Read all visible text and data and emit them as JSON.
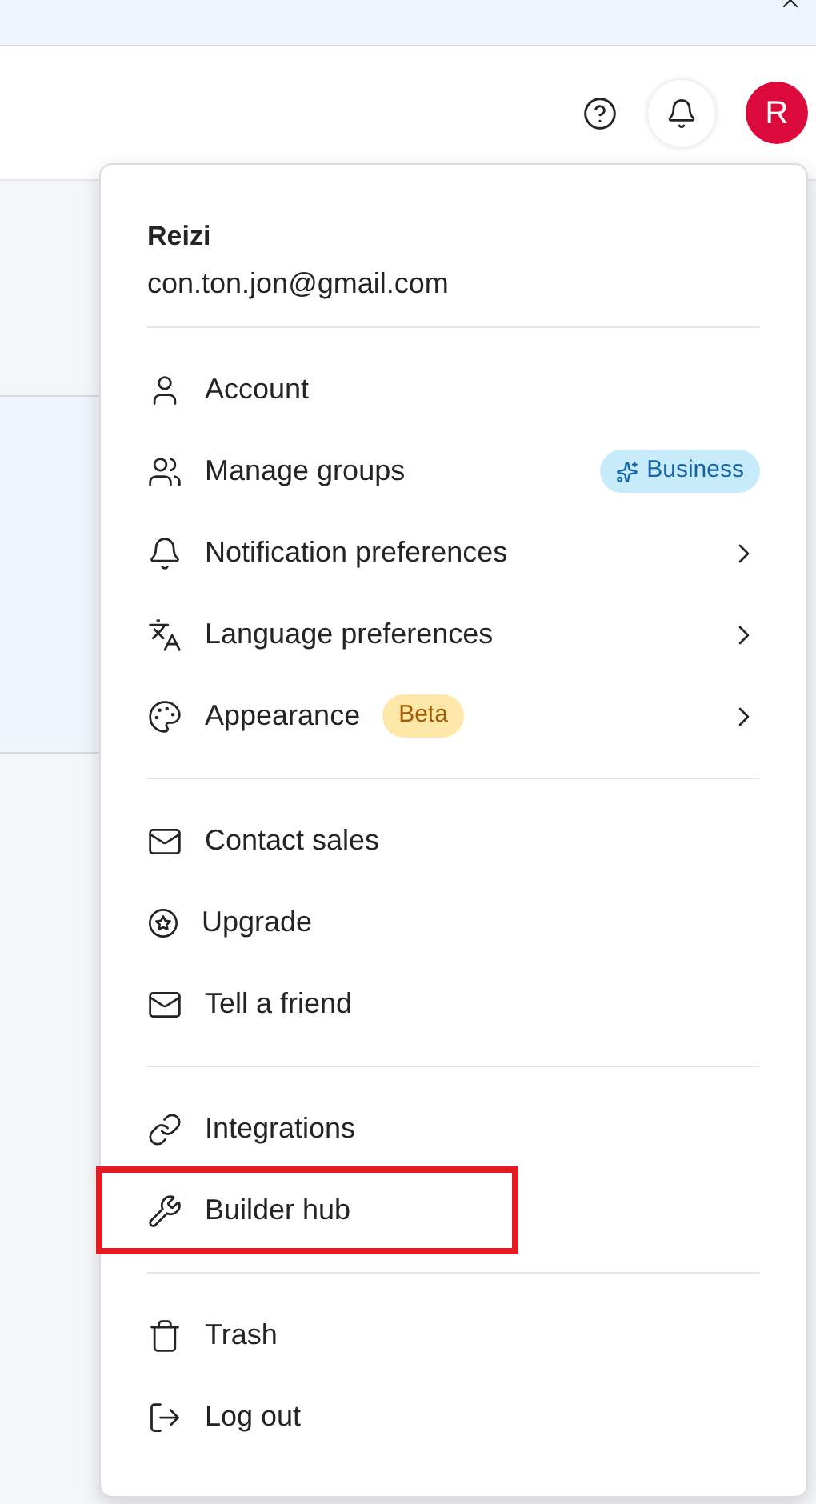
{
  "avatar": {
    "letter": "R"
  },
  "profile": {
    "name": "Reizi",
    "email": "con.ton.jon@gmail.com"
  },
  "menu_sections": [
    [
      {
        "label": "Account",
        "has_submenu": false,
        "highlighted": false
      },
      {
        "label": "Manage groups",
        "has_submenu": false,
        "highlighted": false,
        "badge": {
          "text": "Business",
          "kind": "business"
        }
      },
      {
        "label": "Notification preferences",
        "has_submenu": true,
        "highlighted": false
      },
      {
        "label": "Language preferences",
        "has_submenu": true,
        "highlighted": false
      },
      {
        "label": "Appearance",
        "has_submenu": true,
        "highlighted": false,
        "badge": {
          "text": "Beta",
          "kind": "beta"
        }
      }
    ],
    [
      {
        "label": "Contact sales",
        "has_submenu": false,
        "highlighted": false
      },
      {
        "label": "Upgrade",
        "has_submenu": false,
        "highlighted": false
      },
      {
        "label": "Tell a friend",
        "has_submenu": false,
        "highlighted": false
      }
    ],
    [
      {
        "label": "Integrations",
        "has_submenu": false,
        "highlighted": false
      },
      {
        "label": "Builder hub",
        "has_submenu": false,
        "highlighted": true
      }
    ],
    [
      {
        "label": "Trash",
        "has_submenu": false,
        "highlighted": false
      },
      {
        "label": "Log out",
        "has_submenu": false,
        "highlighted": false
      }
    ]
  ]
}
